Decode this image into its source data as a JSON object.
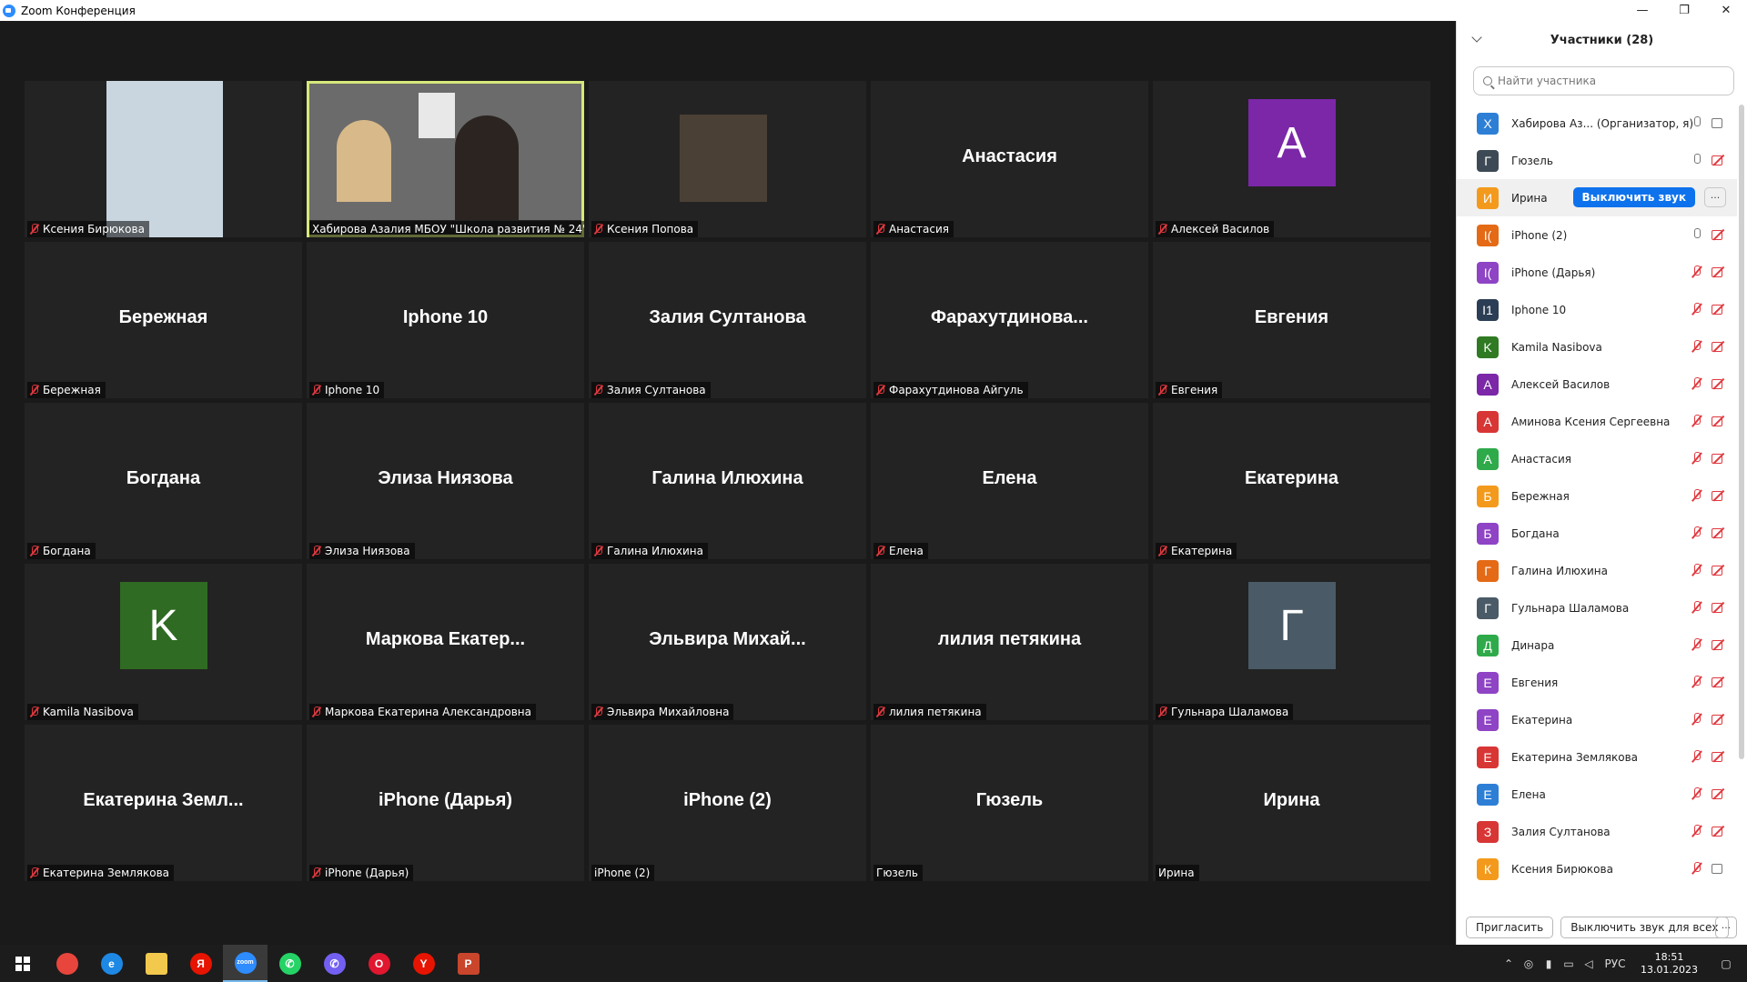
{
  "window": {
    "title": "Zoom Конференция",
    "minimize": "—",
    "restore": "❐",
    "close": "✕"
  },
  "tiles": [
    {
      "label": "Ксения Бирюкова",
      "big": "",
      "muted": true,
      "photo": "#c9d6e0"
    },
    {
      "label": "Хабирова Азалия МБОУ \"Школа развития № 24\"",
      "big": "",
      "muted": false,
      "photo": "#6b6b6b",
      "active": true
    },
    {
      "label": "Ксения Попова",
      "big": "",
      "muted": true,
      "photo": "#4b4036"
    },
    {
      "label": "Анастасия",
      "big": "Анастасия",
      "muted": true
    },
    {
      "label": "Алексей Василов",
      "big": "",
      "muted": true,
      "avatar": "А",
      "avatar_color": "#7b27a8"
    },
    {
      "label": "Бережная",
      "big": "Бережная",
      "muted": true
    },
    {
      "label": "Iphone 10",
      "big": "Iphone 10",
      "muted": true
    },
    {
      "label": "Залия Султанова",
      "big": "Залия Султанова",
      "muted": true
    },
    {
      "label": "Фарахутдинова Айгуль",
      "big": "Фарахутдинова...",
      "muted": true
    },
    {
      "label": "Евгения",
      "big": "Евгения",
      "muted": true
    },
    {
      "label": "Богдана",
      "big": "Богдана",
      "muted": true
    },
    {
      "label": "Элиза Ниязова",
      "big": "Элиза Ниязова",
      "muted": true
    },
    {
      "label": "Галина Илюхина",
      "big": "Галина Илюхина",
      "muted": true
    },
    {
      "label": "Елена",
      "big": "Елена",
      "muted": true
    },
    {
      "label": "Екатерина",
      "big": "Екатерина",
      "muted": true
    },
    {
      "label": "Kamila Nasibova",
      "big": "",
      "muted": true,
      "avatar": "K",
      "avatar_color": "#2f6b22"
    },
    {
      "label": "Маркова Екатерина Александровна",
      "big": "Маркова Екатер...",
      "muted": true
    },
    {
      "label": "Эльвира Михайловна",
      "big": "Эльвира Михай...",
      "muted": true
    },
    {
      "label": "лилия петякина",
      "big": "лилия петякина",
      "muted": true
    },
    {
      "label": "Гульнара Шаламова",
      "big": "",
      "muted": true,
      "avatar": "Г",
      "avatar_color": "#4a5a66"
    },
    {
      "label": "Екатерина Землякова",
      "big": "Екатерина Земл...",
      "muted": true
    },
    {
      "label": "iPhone (Дарья)",
      "big": "iPhone (Дарья)",
      "muted": true
    },
    {
      "label": "iPhone (2)",
      "big": "iPhone (2)",
      "muted": false
    },
    {
      "label": "Гюзель",
      "big": "Гюзель",
      "muted": false
    },
    {
      "label": "Ирина",
      "big": "Ирина",
      "muted": false
    }
  ],
  "panel": {
    "title": "Участники (28)",
    "search_placeholder": "Найти участника",
    "mute_button": "Выключить звук",
    "more": "···",
    "participants": [
      {
        "initial": "Х",
        "color": "#2d7fd6",
        "name": "Хабирова Аз... (Организатор, я)",
        "mic": "on",
        "cam": "on"
      },
      {
        "initial": "Г",
        "color": "#3d4a55",
        "name": "Гюзель",
        "mic": "on",
        "cam": "off"
      },
      {
        "initial": "И",
        "color": "#f39a1d",
        "name": "Ирина",
        "mic": "none",
        "cam": "none",
        "hover": true
      },
      {
        "initial": "I(",
        "color": "#e46a16",
        "name": "iPhone (2)",
        "mic": "on",
        "cam": "off"
      },
      {
        "initial": "I(",
        "color": "#8e44c4",
        "name": "iPhone (Дарья)",
        "mic": "off",
        "cam": "off"
      },
      {
        "initial": "I1",
        "color": "#2b3e55",
        "name": "Iphone 10",
        "mic": "off",
        "cam": "off"
      },
      {
        "initial": "K",
        "color": "#2f7a22",
        "name": "Kamila Nasibova",
        "mic": "off",
        "cam": "off"
      },
      {
        "initial": "А",
        "color": "#7b27a8",
        "name": "Алексей Василов",
        "mic": "off",
        "cam": "off"
      },
      {
        "initial": "А",
        "color": "#d83535",
        "name": "Аминова Ксения Сергеевна",
        "mic": "off",
        "cam": "off"
      },
      {
        "initial": "А",
        "color": "#2eaa4a",
        "name": "Анастасия",
        "mic": "off",
        "cam": "off"
      },
      {
        "initial": "Б",
        "color": "#f39a1d",
        "name": "Бережная",
        "mic": "off",
        "cam": "off"
      },
      {
        "initial": "Б",
        "color": "#8e44c4",
        "name": "Богдана",
        "mic": "off",
        "cam": "off"
      },
      {
        "initial": "Г",
        "color": "#e46a16",
        "name": "Галина Илюхина",
        "mic": "off",
        "cam": "off"
      },
      {
        "initial": "Г",
        "color": "#4a5a66",
        "name": "Гульнара Шаламова",
        "mic": "off",
        "cam": "off"
      },
      {
        "initial": "Д",
        "color": "#2eaa4a",
        "name": "Динара",
        "mic": "off",
        "cam": "off"
      },
      {
        "initial": "Е",
        "color": "#8e44c4",
        "name": "Евгения",
        "mic": "off",
        "cam": "off"
      },
      {
        "initial": "Е",
        "color": "#8e44c4",
        "name": "Екатерина",
        "mic": "off",
        "cam": "off"
      },
      {
        "initial": "Е",
        "color": "#d83535",
        "name": "Екатерина Землякова",
        "mic": "off",
        "cam": "off"
      },
      {
        "initial": "Е",
        "color": "#2d7fd6",
        "name": "Елена",
        "mic": "off",
        "cam": "off"
      },
      {
        "initial": "З",
        "color": "#d83535",
        "name": "Залия Султанова",
        "mic": "off",
        "cam": "off"
      },
      {
        "initial": "К",
        "color": "#f39a1d",
        "name": "Ксения Бирюкова",
        "mic": "off",
        "cam": "on"
      }
    ],
    "invite": "Пригласить",
    "mute_all": "Выключить звук для всех"
  },
  "taskbar": {
    "apps": [
      {
        "name": "chrome-icon",
        "glyph": "",
        "color": "#e8453c"
      },
      {
        "name": "ie-icon",
        "glyph": "e",
        "color": "#1e88e5"
      },
      {
        "name": "explorer-icon",
        "glyph": "",
        "color": "#f2c94c"
      },
      {
        "name": "yandex-icon",
        "glyph": "Я",
        "color": "#e61400"
      },
      {
        "name": "zoom-icon",
        "glyph": "zoom",
        "color": "#2d8cff",
        "active": true
      },
      {
        "name": "whatsapp-icon",
        "glyph": "✆",
        "color": "#25d366"
      },
      {
        "name": "viber-icon",
        "glyph": "✆",
        "color": "#7360f2"
      },
      {
        "name": "opera-icon",
        "glyph": "O",
        "color": "#e0172f"
      },
      {
        "name": "yandex-browser-icon",
        "glyph": "Y",
        "color": "#e61400"
      },
      {
        "name": "powerpoint-icon",
        "glyph": "P",
        "color": "#c9462c"
      }
    ],
    "lang": "РУС",
    "time": "18:51",
    "date": "13.01.2023"
  }
}
